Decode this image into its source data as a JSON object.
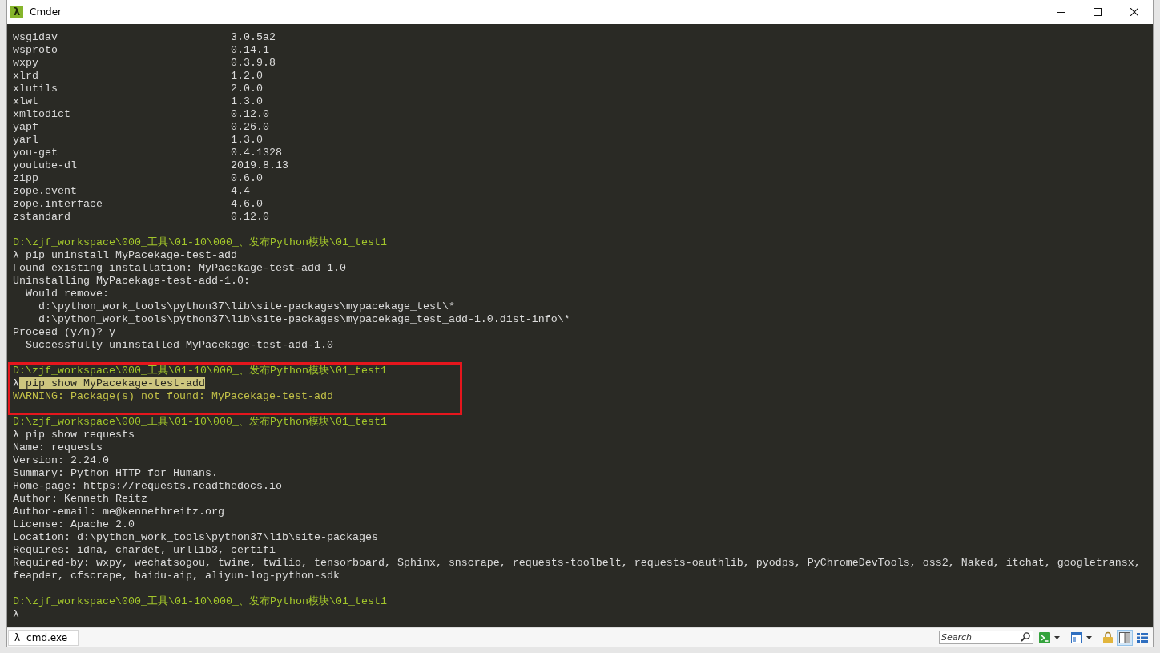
{
  "window": {
    "icon_glyph": "λ",
    "title": "Cmder",
    "controls": [
      {
        "kind": "minimize"
      },
      {
        "kind": "maximize"
      },
      {
        "kind": "close"
      }
    ]
  },
  "terminal": {
    "blocks": [
      {
        "framed": false,
        "lines": [
          {
            "kind": "package",
            "name": "wsgidav",
            "version": "3.0.5a2"
          },
          {
            "kind": "package",
            "name": "wsproto",
            "version": "0.14.1"
          },
          {
            "kind": "package",
            "name": "wxpy",
            "version": "0.3.9.8"
          },
          {
            "kind": "package",
            "name": "xlrd",
            "version": "1.2.0"
          },
          {
            "kind": "package",
            "name": "xlutils",
            "version": "2.0.0"
          },
          {
            "kind": "package",
            "name": "xlwt",
            "version": "1.3.0"
          },
          {
            "kind": "package",
            "name": "xmltodict",
            "version": "0.12.0"
          },
          {
            "kind": "package",
            "name": "yapf",
            "version": "0.26.0"
          },
          {
            "kind": "package",
            "name": "yarl",
            "version": "1.3.0"
          },
          {
            "kind": "package",
            "name": "you-get",
            "version": "0.4.1328"
          },
          {
            "kind": "package",
            "name": "youtube-dl",
            "version": "2019.8.13"
          },
          {
            "kind": "package",
            "name": "zipp",
            "version": "0.6.0"
          },
          {
            "kind": "package",
            "name": "zope.event",
            "version": "4.4"
          },
          {
            "kind": "package",
            "name": "zope.interface",
            "version": "4.6.0"
          },
          {
            "kind": "package",
            "name": "zstandard",
            "version": "0.12.0"
          }
        ]
      },
      {
        "framed": false,
        "lines": [
          {
            "kind": "path",
            "text": "D:\\zjf_workspace\\000_工具\\01-10\\000_、发布Python模块\\01_test1"
          },
          {
            "kind": "command",
            "prompt": "λ",
            "command": "pip uninstall MyPacekage-test-add",
            "highlighted": false
          },
          {
            "kind": "output",
            "text": "Found existing installation: MyPacekage-test-add 1.0"
          },
          {
            "kind": "output",
            "text": "Uninstalling MyPacekage-test-add-1.0:",
            "children": [
              {
                "kind": "output",
                "text": "Would remove:",
                "children": [
                  {
                    "kind": "output",
                    "text": "d:\\python_work_tools\\python37\\lib\\site-packages\\mypacekage_test\\*"
                  },
                  {
                    "kind": "output",
                    "text": "d:\\python_work_tools\\python37\\lib\\site-packages\\mypacekage_test_add-1.0.dist-info\\*"
                  }
                ]
              }
            ]
          },
          {
            "kind": "output",
            "text": "Proceed (y/n)? y",
            "children": [
              {
                "kind": "output",
                "text": "Successfully uninstalled MyPacekage-test-add-1.0"
              }
            ]
          }
        ]
      },
      {
        "framed": true,
        "lines": [
          {
            "kind": "path",
            "text": "D:\\zjf_workspace\\000_工具\\01-10\\000_、发布Python模块\\01_test1"
          },
          {
            "kind": "command",
            "prompt": "λ",
            "command": "pip show MyPacekage-test-add",
            "highlighted": true
          },
          {
            "kind": "warning",
            "text": "WARNING: Package(s) not found: MyPacekage-test-add"
          }
        ]
      },
      {
        "framed": false,
        "lines": [
          {
            "kind": "path",
            "text": "D:\\zjf_workspace\\000_工具\\01-10\\000_、发布Python模块\\01_test1"
          },
          {
            "kind": "command",
            "prompt": "λ",
            "command": "pip show requests",
            "highlighted": false
          },
          {
            "kind": "output",
            "text": "Name: requests"
          },
          {
            "kind": "output",
            "text": "Version: 2.24.0"
          },
          {
            "kind": "output",
            "text": "Summary: Python HTTP for Humans."
          },
          {
            "kind": "output",
            "text": "Home-page: https://requests.readthedocs.io"
          },
          {
            "kind": "output",
            "text": "Author: Kenneth Reitz"
          },
          {
            "kind": "output",
            "text": "Author-email: me@kennethreitz.org"
          },
          {
            "kind": "output",
            "text": "License: Apache 2.0"
          },
          {
            "kind": "output",
            "text": "Location: d:\\python_work_tools\\python37\\lib\\site-packages"
          },
          {
            "kind": "output",
            "text": "Requires: idna, chardet, urllib3, certifi"
          },
          {
            "kind": "output",
            "text": "Required-by: wxpy, wechatsogou, twine, twilio, tensorboard, Sphinx, snscrape, requests-toolbelt, requests-oauthlib, pyodps, PyChromeDevTools, oss2, Naked, itchat, googletransx, feapder, cfscrape, baidu-aip, aliyun-log-python-sdk"
          }
        ]
      },
      {
        "framed": false,
        "lines": [
          {
            "kind": "path",
            "text": "D:\\zjf_workspace\\000_工具\\01-10\\000_、发布Python模块\\01_test1"
          },
          {
            "kind": "command",
            "prompt": "λ"
          }
        ]
      }
    ]
  },
  "tab_bar": {
    "tabs": [
      {
        "icon_glyph": "λ",
        "label": "cmd.exe",
        "selected": true
      }
    ],
    "search": {
      "placeholder": "Search"
    },
    "tools": [
      {
        "kind": "console",
        "dropdown": true,
        "selected": false
      },
      {
        "kind": "window",
        "dropdown": true,
        "selected": false
      },
      {
        "kind": "lock",
        "dropdown": false,
        "selected": false
      },
      {
        "kind": "split",
        "dropdown": false,
        "selected": true
      },
      {
        "kind": "list",
        "dropdown": false,
        "selected": false
      }
    ]
  }
}
